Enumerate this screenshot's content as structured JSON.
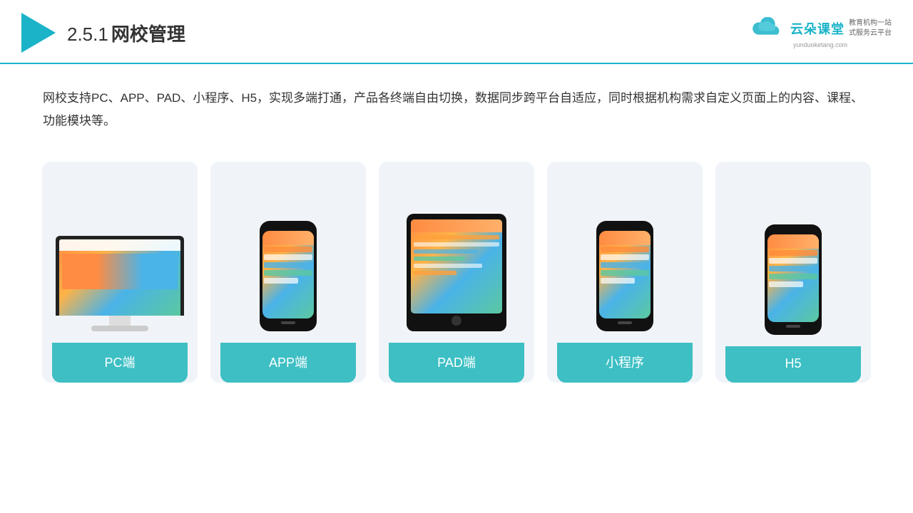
{
  "header": {
    "title": "网校管理",
    "title_prefix": "2.5.1",
    "brand": {
      "name": "云朵课堂",
      "url": "yunduoketang.com",
      "slogan_line1": "教育机构一站",
      "slogan_line2": "式服务云平台"
    }
  },
  "description": "网校支持PC、APP、PAD、小程序、H5，实现多端打通，产品各终端自由切换，数据同步跨平台自适应，同时根据机构需求自定义页面上的内容、课程、功能模块等。",
  "cards": [
    {
      "id": "pc",
      "label": "PC端",
      "type": "pc"
    },
    {
      "id": "app",
      "label": "APP端",
      "type": "phone"
    },
    {
      "id": "pad",
      "label": "PAD端",
      "type": "tablet"
    },
    {
      "id": "mini",
      "label": "小程序",
      "type": "phone"
    },
    {
      "id": "h5",
      "label": "H5",
      "type": "phone"
    }
  ]
}
